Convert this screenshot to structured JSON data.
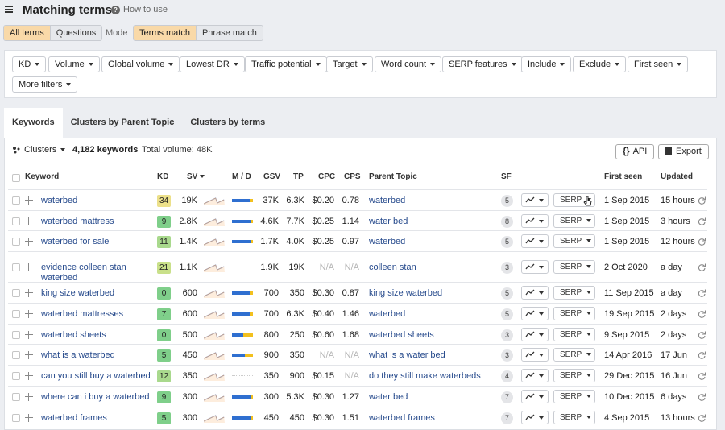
{
  "header": {
    "title": "Matching terms",
    "how_to_use": "How to use"
  },
  "terms_toggle": [
    "All terms",
    "Questions"
  ],
  "mode_label": "Mode",
  "mode_toggle": [
    "Terms match",
    "Phrase match"
  ],
  "filters": [
    "KD",
    "Volume",
    "Global volume",
    "Lowest DR",
    "Traffic potential",
    "Target",
    "Word count",
    "SERP features",
    "Include",
    "Exclude",
    "First seen",
    "More filters"
  ],
  "tabs": [
    "Keywords",
    "Clusters by Parent Topic",
    "Clusters by terms"
  ],
  "toolbar": {
    "clusters": "Clusters",
    "keyword_count": "4,182 keywords",
    "total_volume": "Total volume: 48K",
    "api": "API",
    "export": "Export"
  },
  "columns": {
    "keyword": "Keyword",
    "kd": "KD",
    "sv": "SV",
    "md": "M / D",
    "gsv": "GSV",
    "tp": "TP",
    "cpc": "CPC",
    "cps": "CPS",
    "parent": "Parent Topic",
    "sf": "SF",
    "first_seen": "First seen",
    "updated": "Updated"
  },
  "serp_label": "SERP",
  "colors": {
    "kd_yellow": "#ece08a",
    "kd_lightgreen": "#a9d98d",
    "kd_green": "#7fcf8a",
    "link": "#264a8c",
    "mobile": "#2f6fd0",
    "desktop": "#f2c01e",
    "trend_blue": "#6d95dd",
    "trend_orange": "#f0a864"
  },
  "rows": [
    {
      "keyword": [
        "waterbed"
      ],
      "kd": "34",
      "kd_color": "#ece08a",
      "sv": "19K",
      "mobile_share": 0.85,
      "gsv": "37K",
      "tp": "6.3K",
      "cpc": "$0.20",
      "cps": "0.78",
      "parent": "waterbed",
      "sf": "5",
      "first_seen": "1 Sep 2015",
      "updated": "15 hours"
    },
    {
      "keyword": [
        "waterbed mattress"
      ],
      "kd": "9",
      "kd_color": "#7fcf8a",
      "sv": "2.8K",
      "mobile_share": 0.88,
      "gsv": "4.6K",
      "tp": "7.7K",
      "cpc": "$0.25",
      "cps": "1.14",
      "parent": "water bed",
      "sf": "8",
      "first_seen": "1 Sep 2015",
      "updated": "3 hours"
    },
    {
      "keyword": [
        "waterbed for sale"
      ],
      "kd": "11",
      "kd_color": "#a9d98d",
      "sv": "1.4K",
      "mobile_share": 0.9,
      "gsv": "1.7K",
      "tp": "4.0K",
      "cpc": "$0.25",
      "cps": "0.97",
      "parent": "waterbed",
      "sf": "5",
      "first_seen": "1 Sep 2015",
      "updated": "12 hours"
    },
    {
      "keyword": [
        "evidence colleen stan",
        "waterbed"
      ],
      "kd": "21",
      "kd_color": "#c9e08a",
      "sv": "1.1K",
      "mobile_share": null,
      "gsv": "1.9K",
      "tp": "19K",
      "cpc": "N/A",
      "cps": "N/A",
      "parent": "colleen stan",
      "sf": "3",
      "first_seen": "2 Oct 2020",
      "updated": "a day"
    },
    {
      "keyword": [
        "king size waterbed"
      ],
      "kd": "0",
      "kd_color": "#7fcf8a",
      "sv": "600",
      "mobile_share": 0.85,
      "gsv": "700",
      "tp": "350",
      "cpc": "$0.30",
      "cps": "0.87",
      "parent": "king size waterbed",
      "sf": "5",
      "first_seen": "11 Sep 2015",
      "updated": "a day"
    },
    {
      "keyword": [
        "waterbed mattresses"
      ],
      "kd": "7",
      "kd_color": "#7fcf8a",
      "sv": "600",
      "mobile_share": 0.85,
      "gsv": "700",
      "tp": "6.3K",
      "cpc": "$0.40",
      "cps": "1.46",
      "parent": "waterbed",
      "sf": "5",
      "first_seen": "19 Sep 2015",
      "updated": "2 days"
    },
    {
      "keyword": [
        "waterbed sheets"
      ],
      "kd": "0",
      "kd_color": "#7fcf8a",
      "sv": "500",
      "mobile_share": 0.55,
      "gsv": "800",
      "tp": "250",
      "cpc": "$0.60",
      "cps": "1.68",
      "parent": "waterbed sheets",
      "sf": "3",
      "first_seen": "9 Sep 2015",
      "updated": "2 days"
    },
    {
      "keyword": [
        "what is a waterbed"
      ],
      "kd": "5",
      "kd_color": "#7fcf8a",
      "sv": "450",
      "mobile_share": 0.6,
      "gsv": "900",
      "tp": "350",
      "cpc": "N/A",
      "cps": "N/A",
      "parent": "what is a water bed",
      "sf": "3",
      "first_seen": "14 Apr 2016",
      "updated": "17 Jun"
    },
    {
      "keyword": [
        "can you still buy a waterbed"
      ],
      "kd": "12",
      "kd_color": "#a9d98d",
      "sv": "350",
      "mobile_share": null,
      "gsv": "350",
      "tp": "900",
      "cpc": "$0.15",
      "cps": "N/A",
      "parent": "do they still make waterbeds",
      "sf": "4",
      "first_seen": "29 Dec 2015",
      "updated": "16 Jun"
    },
    {
      "keyword": [
        "where can i buy a waterbed"
      ],
      "kd": "9",
      "kd_color": "#7fcf8a",
      "sv": "300",
      "mobile_share": 0.9,
      "gsv": "300",
      "tp": "5.3K",
      "cpc": "$0.30",
      "cps": "1.27",
      "parent": "water bed",
      "sf": "7",
      "first_seen": "10 Dec 2015",
      "updated": "6 days"
    },
    {
      "keyword": [
        "waterbed frames"
      ],
      "kd": "5",
      "kd_color": "#7fcf8a",
      "sv": "300",
      "mobile_share": 0.88,
      "gsv": "450",
      "tp": "450",
      "cpc": "$0.30",
      "cps": "1.51",
      "parent": "waterbed frames",
      "sf": "7",
      "first_seen": "4 Sep 2015",
      "updated": "13 hours"
    }
  ]
}
